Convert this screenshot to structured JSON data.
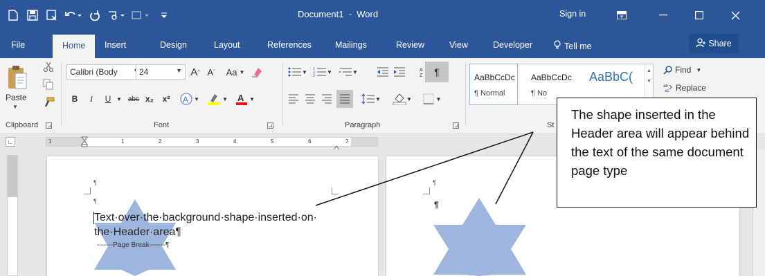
{
  "window": {
    "title": "Document1  -  Word",
    "sign_in": "Sign in"
  },
  "tabs": [
    {
      "label": "File"
    },
    {
      "label": "Home"
    },
    {
      "label": "Insert"
    },
    {
      "label": "Design"
    },
    {
      "label": "Layout"
    },
    {
      "label": "References"
    },
    {
      "label": "Mailings"
    },
    {
      "label": "Review"
    },
    {
      "label": "View"
    },
    {
      "label": "Developer"
    }
  ],
  "tell_me": "Tell me",
  "share": "Share",
  "ribbon": {
    "clipboard": {
      "paste": "Paste",
      "label": "Clipboard"
    },
    "font": {
      "name": "Calibri (Body",
      "size": "24",
      "case_label": "Aa",
      "bold": "B",
      "italic": "I",
      "underline": "U",
      "strike": "abc",
      "subscript": "x₂",
      "superscript": "x²",
      "label": "Font"
    },
    "paragraph": {
      "label": "Paragraph"
    },
    "styles": {
      "items": [
        {
          "sample": "AaBbCcDc",
          "name": "¶ Normal"
        },
        {
          "sample": "AaBbCcDc",
          "name": "¶ No"
        },
        {
          "sample": "AaBbC("
        }
      ],
      "label": "St"
    },
    "editing": {
      "find": "Find",
      "replace": "Replace"
    }
  },
  "ruler": {
    "numbers": [
      "1",
      "1",
      "2",
      "3",
      "4",
      "5",
      "6",
      "7"
    ]
  },
  "document": {
    "line1": "Text·over·the·background·shape·inserted·on·",
    "line2": "the·Header·area¶",
    "page_break": "-------Page Break-------¶"
  },
  "callout": {
    "text": "The shape inserted in the Header area will appear behind the text of the same document page type"
  },
  "colors": {
    "accent": "#2b579a",
    "shape_fill": "#9eb6de"
  }
}
